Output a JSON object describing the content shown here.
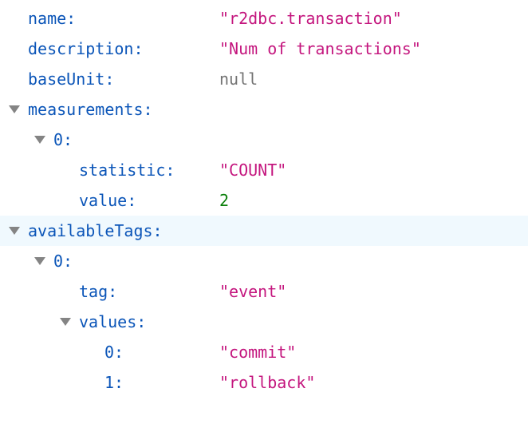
{
  "json": {
    "name": {
      "key": "name:",
      "value": "\"r2dbc.transaction\""
    },
    "description": {
      "key": "description:",
      "value": "\"Num of transactions\""
    },
    "baseUnit": {
      "key": "baseUnit:",
      "value": "null"
    },
    "measurements": {
      "key": "measurements:",
      "item0": {
        "key": "0:",
        "statistic": {
          "key": "statistic:",
          "value": "\"COUNT\""
        },
        "value": {
          "key": "value:",
          "value": "2"
        }
      }
    },
    "availableTags": {
      "key": "availableTags:",
      "item0": {
        "key": "0:",
        "tag": {
          "key": "tag:",
          "value": "\"event\""
        },
        "values": {
          "key": "values:",
          "items": [
            {
              "key": "0:",
              "value": "\"commit\""
            },
            {
              "key": "1:",
              "value": "\"rollback\""
            }
          ]
        }
      }
    }
  },
  "colors": {
    "key": "#0b55b8",
    "string": "#c4167e",
    "number": "#0a7f0a",
    "null": "#737373",
    "toggle": "#848484",
    "row_highlight": "#f0f9fe"
  }
}
